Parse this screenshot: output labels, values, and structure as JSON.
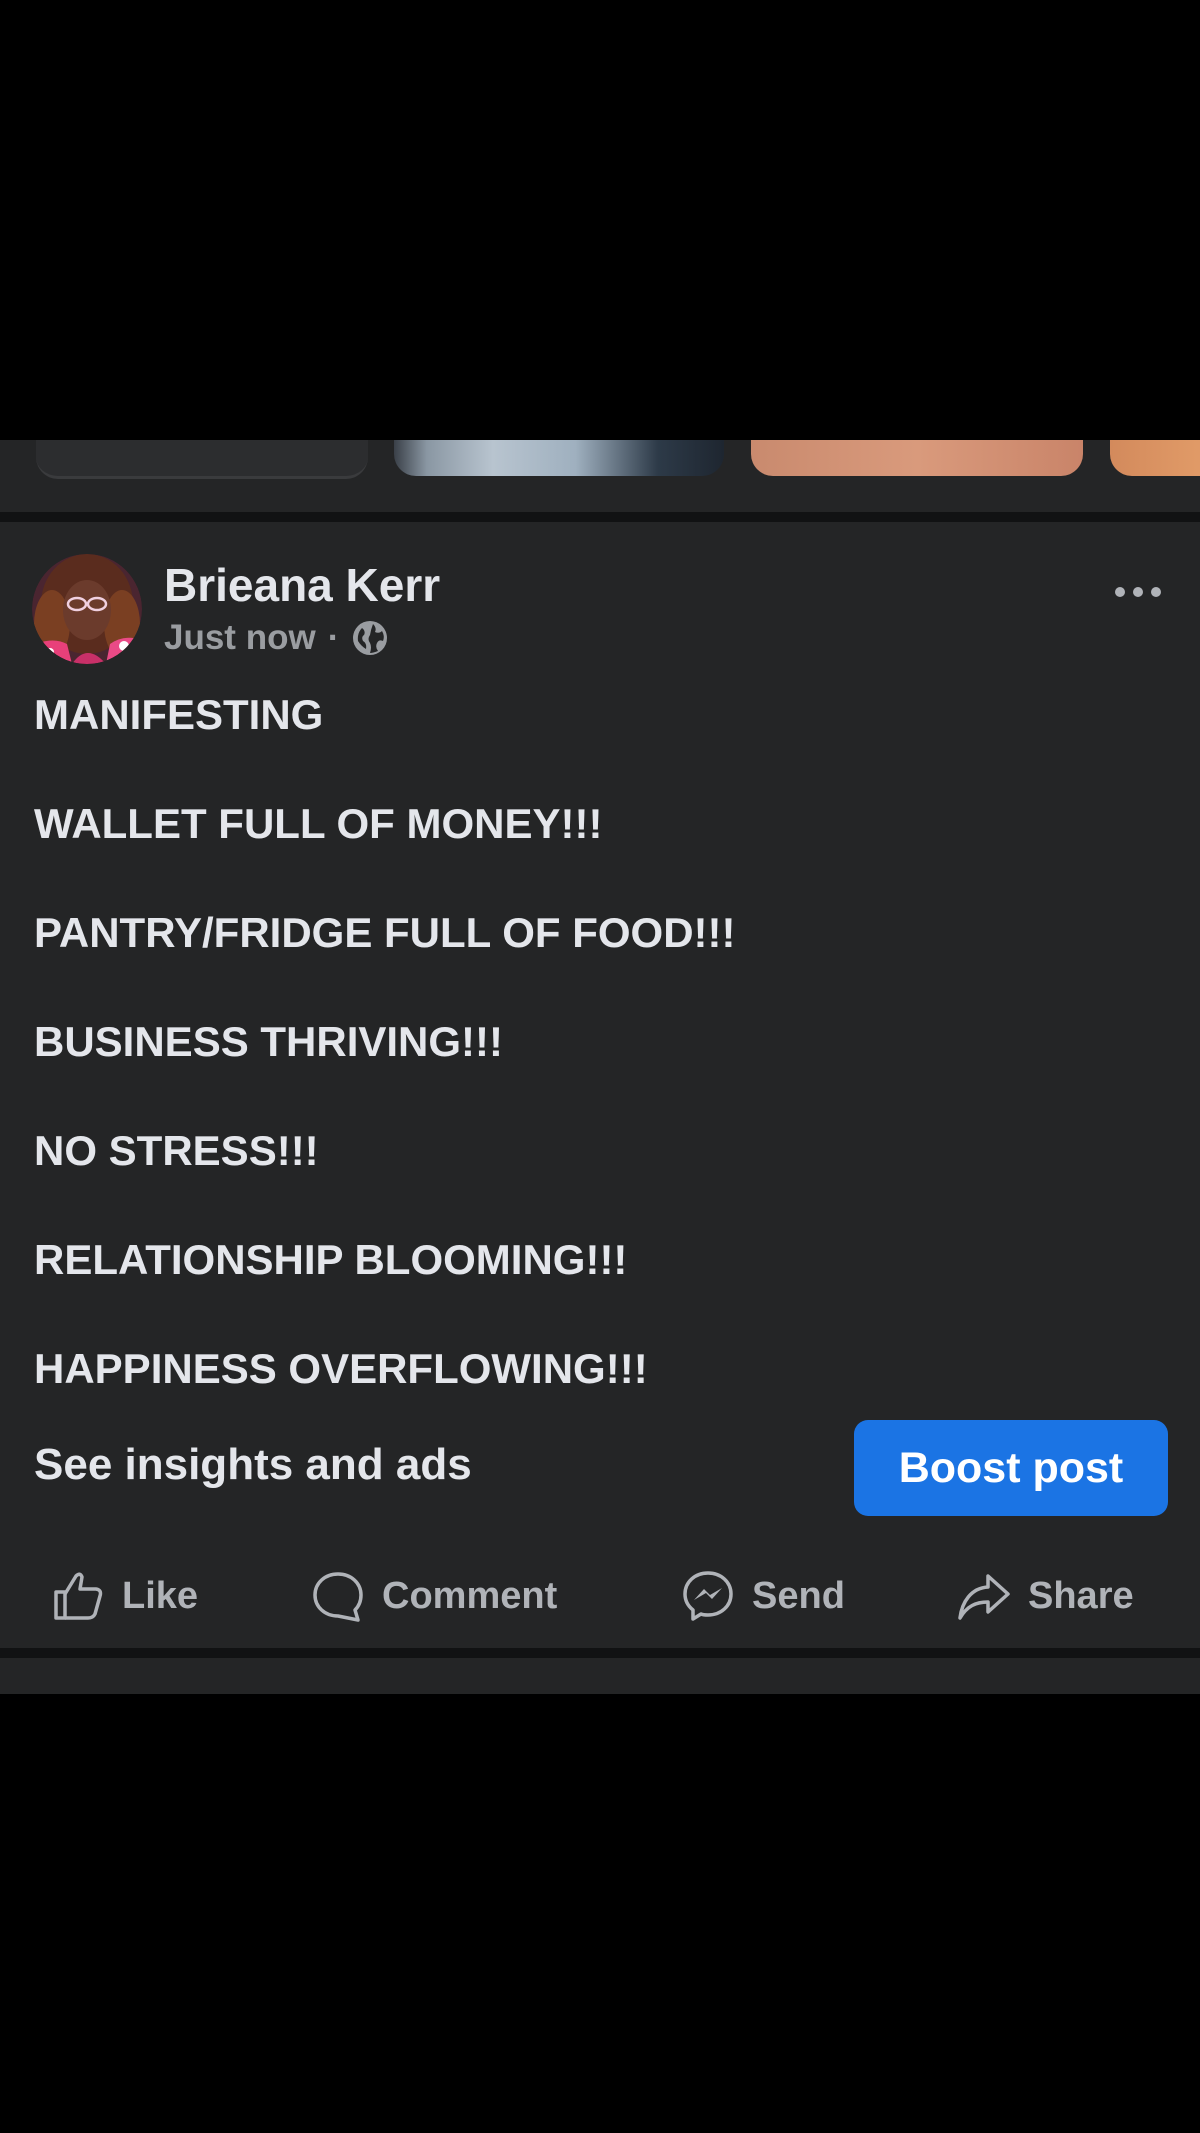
{
  "post": {
    "author": "Brieana Kerr",
    "timestamp": "Just now",
    "separator": "·",
    "audience_icon": "globe-icon",
    "more_icon": "more-horizontal-icon",
    "lines": [
      "MANIFESTING",
      "WALLET FULL OF MONEY!!!",
      "PANTRY/FRIDGE FULL OF FOOD!!!",
      "BUSINESS THRIVING!!!",
      "NO STRESS!!!",
      "RELATIONSHIP BLOOMING!!!",
      "HAPPINESS OVERFLOWING!!!"
    ],
    "insights_label": "See insights and ads",
    "boost_label": "Boost post"
  },
  "actions": {
    "like": "Like",
    "comment": "Comment",
    "send": "Send",
    "share": "Share"
  },
  "colors": {
    "background": "#000000",
    "card": "#242526",
    "text_primary": "#e4e6eb",
    "text_secondary": "#b0b3b8",
    "accent": "#1b74e4"
  }
}
